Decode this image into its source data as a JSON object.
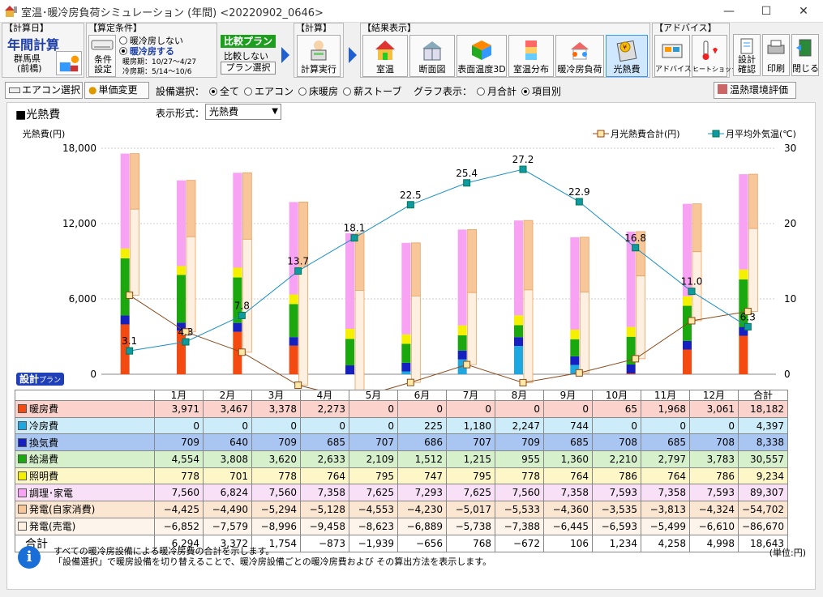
{
  "window": {
    "title": "室温･暖冷房負荷シミュレーション (年間) <20220902_0646>",
    "minimize": "—",
    "maximize": "☐",
    "close": "✕"
  },
  "toolbar": {
    "calc_day": {
      "group_title": "【計算日】",
      "main": "年間計算",
      "region": "群馬県",
      "city": "(前橋)"
    },
    "conditions": {
      "group_title": "【算定条件】",
      "cond_button": "条件設定",
      "opt_off": "暖冷房しない",
      "opt_on": "暖冷房する",
      "heat_period": "暖房期：10/27～4/27",
      "cool_period": "冷房期：5/14～10/6"
    },
    "compare": {
      "plan_button": "比較プラン",
      "no_compare": "比較しない",
      "plan_select": "プラン選択"
    },
    "calc": {
      "group_title": "【計算】",
      "run": "計算実行"
    },
    "results": {
      "group_title": "【結果表示】",
      "buttons": [
        "室温",
        "断面図",
        "表面温度3D",
        "室温分布",
        "暖冷房負荷",
        "光熱費"
      ]
    },
    "advice": {
      "group_title": "【アドバイス】",
      "buttons": [
        "アドバイス",
        "ヒートショック"
      ]
    },
    "misc": {
      "buttons": [
        "設計確認",
        "印刷",
        "閉じる"
      ]
    }
  },
  "subbar": {
    "aircon_button": "エアコン選択",
    "price_button": "単価変更",
    "equip_label": "設備選択：",
    "equip_options": [
      "全て",
      "エアコン",
      "床暖房",
      "薪ストーブ"
    ],
    "graph_label": "グラフ表示：",
    "graph_options": [
      "月合計",
      "項目別"
    ],
    "eval_button": "温熱環境評価"
  },
  "panel": {
    "title": "■光熱費",
    "format_label": "表示形式：",
    "format_value": "光熱費",
    "design_badge": "設計",
    "plan_badge": "プラン"
  },
  "chart_data": {
    "type": "bar",
    "ylabel_left": "光熱費(円)",
    "ylim_left": [
      0,
      18000
    ],
    "yticks_left": [
      "0",
      "6,000",
      "12,000",
      "18,000"
    ],
    "ylim_right": [
      0,
      30
    ],
    "yticks_right": [
      "0",
      "10",
      "20",
      "30"
    ],
    "ylabel_right": "月平均外気温(℃)",
    "legend": [
      "月光熱費合計(円)",
      "月平均外気温(℃)"
    ],
    "legend_position": "top-right",
    "categories": [
      "1月",
      "2月",
      "3月",
      "4月",
      "5月",
      "6月",
      "7月",
      "8月",
      "9月",
      "10月",
      "11月",
      "12月"
    ],
    "series": [
      {
        "name": "暖房費",
        "color": "#f24a10",
        "values": [
          3971,
          3467,
          3378,
          2273,
          0,
          0,
          0,
          0,
          0,
          65,
          1968,
          3061
        ]
      },
      {
        "name": "冷房費",
        "color": "#1fa7e0",
        "values": [
          0,
          0,
          0,
          0,
          0,
          225,
          1180,
          2247,
          744,
          0,
          0,
          0
        ]
      },
      {
        "name": "換気費",
        "color": "#1620c0",
        "values": [
          709,
          640,
          709,
          685,
          707,
          686,
          707,
          709,
          685,
          708,
          685,
          708
        ]
      },
      {
        "name": "給湯費",
        "color": "#1aa80e",
        "values": [
          4554,
          3808,
          3620,
          2633,
          2109,
          1512,
          1215,
          955,
          1360,
          2210,
          2797,
          3783
        ]
      },
      {
        "name": "照明費",
        "color": "#f5f000",
        "values": [
          778,
          701,
          778,
          764,
          795,
          747,
          795,
          778,
          764,
          786,
          764,
          786
        ]
      },
      {
        "name": "調理・家電",
        "color": "#f7a2f2",
        "values": [
          7560,
          6824,
          7560,
          7358,
          7625,
          7293,
          7625,
          7560,
          7358,
          7593,
          7358,
          7593
        ]
      },
      {
        "name": "発電(自家消費)",
        "color": "#f7c79a",
        "values": [
          -4425,
          -4490,
          -5294,
          -5128,
          -4553,
          -4230,
          -5017,
          -5533,
          -4360,
          -3535,
          -3813,
          -4324
        ]
      },
      {
        "name": "発電(売電)",
        "color": "#fdf0e0",
        "values": [
          -6852,
          -7579,
          -8996,
          -9458,
          -8623,
          -6889,
          -5738,
          -7388,
          -6445,
          -6593,
          -5499,
          -6610
        ]
      }
    ],
    "totals": [
      6294,
      3372,
      1754,
      -873,
      -1939,
      -656,
      768,
      -672,
      106,
      1234,
      4258,
      4998
    ],
    "temperature": [
      3.1,
      4.3,
      7.8,
      13.7,
      18.1,
      22.5,
      25.4,
      27.2,
      22.9,
      16.8,
      11.0,
      6.3
    ],
    "temperature_labels": [
      "3.1",
      "4.3",
      "7.8",
      "13.7",
      "18.1",
      "22.5",
      "25.4",
      "27.2",
      "22.9",
      "16.8",
      "11.0",
      "6.3"
    ]
  },
  "table": {
    "headers": [
      "1月",
      "2月",
      "3月",
      "4月",
      "5月",
      "6月",
      "7月",
      "8月",
      "9月",
      "10月",
      "11月",
      "12月",
      "合計"
    ],
    "rows": [
      {
        "label": "暖房費",
        "color": "#f24a10",
        "bg": "#fbd3cc",
        "cells": [
          "3,971",
          "3,467",
          "3,378",
          "2,273",
          "0",
          "0",
          "0",
          "0",
          "0",
          "65",
          "1,968",
          "3,061",
          "18,182"
        ]
      },
      {
        "label": "冷房費",
        "color": "#1fa7e0",
        "bg": "#ccecfa",
        "cells": [
          "0",
          "0",
          "0",
          "0",
          "0",
          "225",
          "1,180",
          "2,247",
          "744",
          "0",
          "0",
          "0",
          "4,397"
        ]
      },
      {
        "label": "換気費",
        "color": "#1620c0",
        "bg": "#a9c6f2",
        "cells": [
          "709",
          "640",
          "709",
          "685",
          "707",
          "686",
          "707",
          "709",
          "685",
          "708",
          "685",
          "708",
          "8,338"
        ]
      },
      {
        "label": "給湯費",
        "color": "#1aa80e",
        "bg": "#d6f0cc",
        "cells": [
          "4,554",
          "3,808",
          "3,620",
          "2,633",
          "2,109",
          "1,512",
          "1,215",
          "955",
          "1,360",
          "2,210",
          "2,797",
          "3,783",
          "30,557"
        ]
      },
      {
        "label": "照明費",
        "color": "#f5f000",
        "bg": "#fdf6c6",
        "cells": [
          "778",
          "701",
          "778",
          "764",
          "795",
          "747",
          "795",
          "778",
          "764",
          "786",
          "764",
          "786",
          "9,234"
        ]
      },
      {
        "label": "調理･家電",
        "color": "#f7a2f2",
        "bg": "#f8e0f6",
        "cells": [
          "7,560",
          "6,824",
          "7,560",
          "7,358",
          "7,625",
          "7,293",
          "7,625",
          "7,560",
          "7,358",
          "7,593",
          "7,358",
          "7,593",
          "89,307"
        ]
      },
      {
        "label": "発電(自家消費)",
        "color": "#f7c79a",
        "bg": "#fbe6d2",
        "cells": [
          "−4,425",
          "−4,490",
          "−5,294",
          "−5,128",
          "−4,553",
          "−4,230",
          "−5,017",
          "−5,533",
          "−4,360",
          "−3,535",
          "−3,813",
          "−4,324",
          "−54,702"
        ]
      },
      {
        "label": "発電(売電)",
        "color": "#fdf0e0",
        "bg": "#fdf5ec",
        "cells": [
          "−6,852",
          "−7,579",
          "−8,996",
          "−9,458",
          "−8,623",
          "−6,889",
          "−5,738",
          "−7,388",
          "−6,445",
          "−6,593",
          "−5,499",
          "−6,610",
          "−86,670"
        ]
      }
    ],
    "total_row": {
      "label": "合計",
      "cells": [
        "6,294",
        "3,372",
        "1,754",
        "−873",
        "−1,939",
        "−656",
        "768",
        "−672",
        "106",
        "1,234",
        "4,258",
        "4,998",
        "18,643"
      ]
    }
  },
  "info": {
    "line1": "すべての暖冷房設備による暖冷房費の合計を示します。",
    "line2": "「設備選択」で暖房設備を切り替えることで、暖冷房設備ごとの暖冷房費および その算出方法を表示します。",
    "unit": "(単位:円)"
  }
}
